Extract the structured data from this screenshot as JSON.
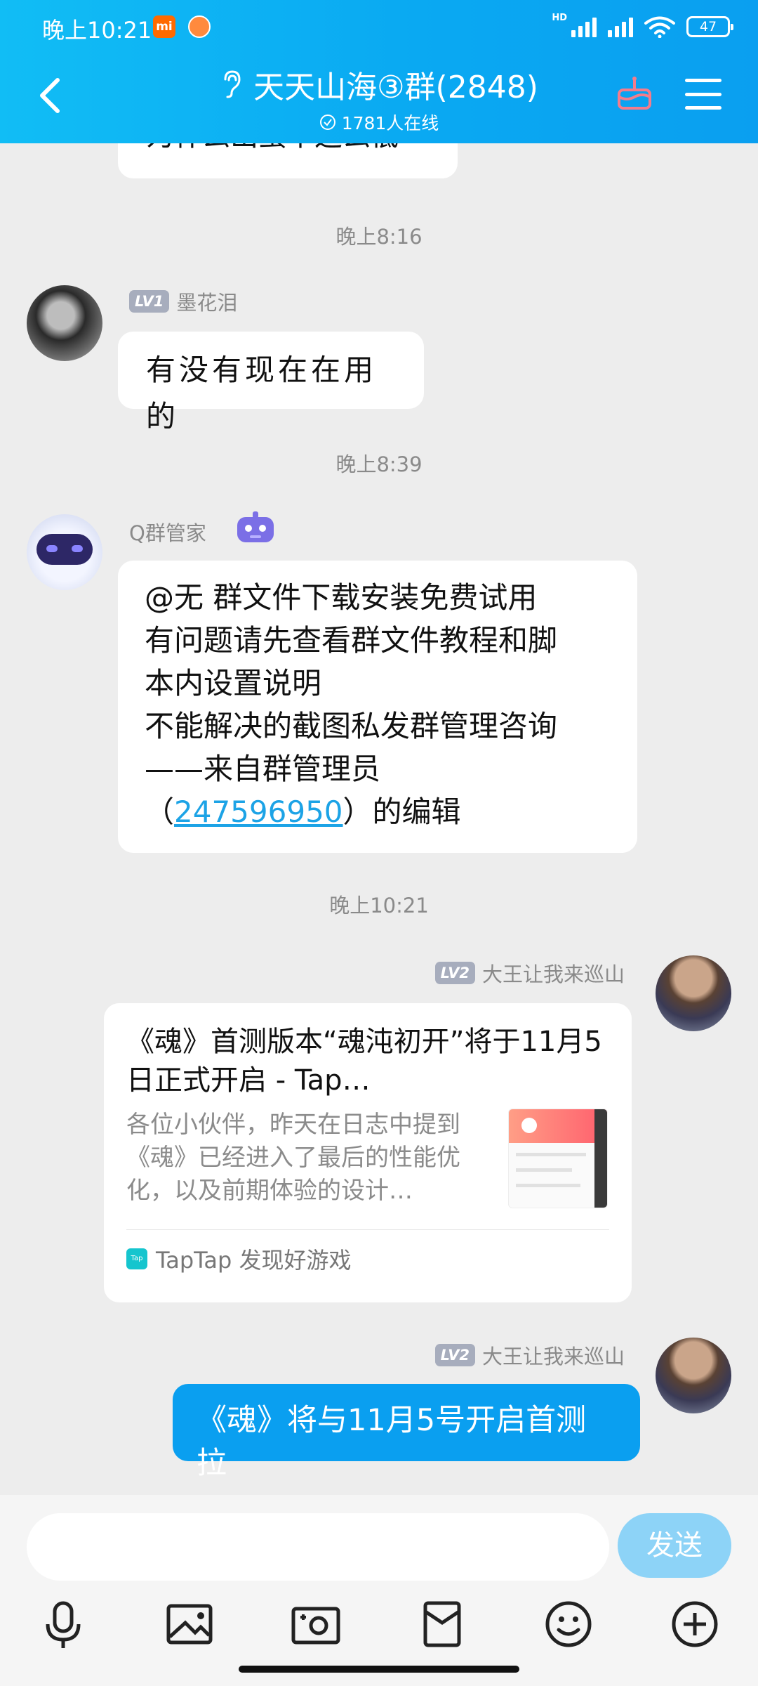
{
  "status_bar": {
    "time": "晚上10:21",
    "mi_badge": "mi",
    "network": "HD",
    "battery": "47"
  },
  "header": {
    "title": "天天山海③群(2848)",
    "online": "1781人在线"
  },
  "chat": {
    "partial_message": "为什么出蛋率这么低",
    "time_1": "晚上8:16",
    "msg1": {
      "level": "LV1",
      "sender": "墨花泪",
      "text": "有没有现在在用的"
    },
    "time_2": "晚上8:39",
    "msg2": {
      "sender": "Q群管家",
      "lines": [
        "@无 群文件下载安装免费试用",
        "有问题请先查看群文件教程和脚",
        "本内设置说明",
        "不能解决的截图私发群管理咨询",
        "——来自群管理员"
      ],
      "last_open": "（",
      "link": "247596950",
      "last_close": "）的编辑"
    },
    "time_3": "晚上10:21",
    "msg3": {
      "level": "LV2",
      "sender": "大王让我来巡山",
      "card_title": "《魂》首测版本“魂沌初开”将于11月5日正式开启 - Tap…",
      "card_desc": "各位小伙伴，昨天在日志中提到《魂》已经进入了最后的性能优化，以及前期体验的设计…",
      "source_icon": "Tap",
      "source": "TapTap 发现好游戏"
    },
    "msg4": {
      "level": "LV2",
      "sender": "大王让我来巡山",
      "text": "《魂》将与11月5号开启首测拉"
    }
  },
  "input": {
    "placeholder": "",
    "send_label": "发送"
  },
  "toolbar": [
    "mic-icon",
    "image-icon",
    "camera-icon",
    "red-packet-icon",
    "emoji-icon",
    "plus-icon"
  ],
  "colors": {
    "header": "#0aa9f2",
    "bubble_self": "#0a9ff0",
    "link": "#1ca3e6",
    "send": "#8dd3f7"
  }
}
